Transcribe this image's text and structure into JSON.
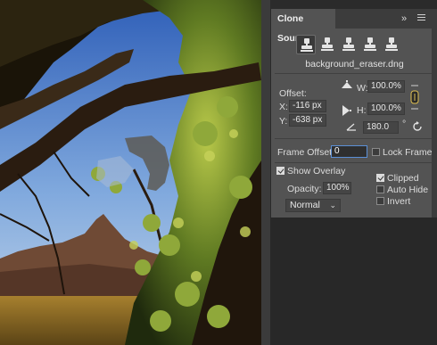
{
  "panel": {
    "tab_title": "Clone Source",
    "expand_glyph": "»",
    "menu_icon": "hamburger-menu-icon",
    "source_buttons": [
      "clone-source-1",
      "clone-source-2",
      "clone-source-3",
      "clone-source-4",
      "clone-source-5"
    ],
    "active_source_index": 0,
    "filename": "background_eraser.dng",
    "offset_label": "Offset:",
    "x_label": "X:",
    "x_value": "-116 px",
    "y_label": "Y:",
    "y_value": "-638 px",
    "w_label": "W:",
    "w_value": "100.0%",
    "h_label": "H:",
    "h_value": "100.0%",
    "angle_value": "180.0",
    "degree_symbol": "°",
    "frame_offset_label": "Frame Offset:",
    "frame_offset_value": "0",
    "lock_frame_label": "Lock Frame",
    "lock_frame_checked": false,
    "show_overlay_label": "Show Overlay",
    "show_overlay_checked": true,
    "opacity_label": "Opacity:",
    "opacity_value": "100%",
    "blend_mode": "Normal",
    "clipped_label": "Clipped",
    "clipped_checked": true,
    "auto_hide_label": "Auto Hide",
    "auto_hide_checked": false,
    "invert_label": "Invert",
    "invert_checked": false
  },
  "colors": {
    "panel_bg": "#535353",
    "tab_bar": "#3c3c3c",
    "focus_border": "#5b8fd6",
    "app_bg": "#282828"
  }
}
